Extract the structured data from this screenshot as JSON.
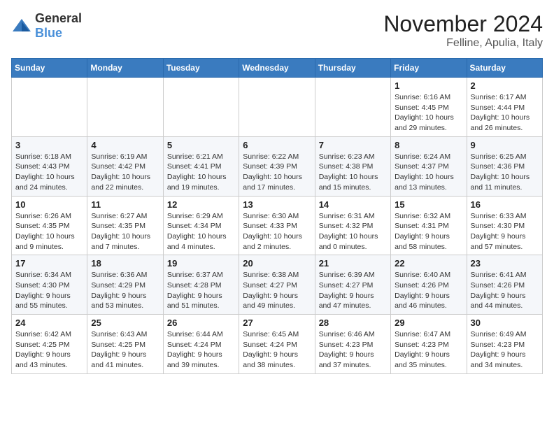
{
  "header": {
    "logo_general": "General",
    "logo_blue": "Blue",
    "month_title": "November 2024",
    "location": "Felline, Apulia, Italy"
  },
  "weekdays": [
    "Sunday",
    "Monday",
    "Tuesday",
    "Wednesday",
    "Thursday",
    "Friday",
    "Saturday"
  ],
  "weeks": [
    [
      {
        "day": "",
        "info": ""
      },
      {
        "day": "",
        "info": ""
      },
      {
        "day": "",
        "info": ""
      },
      {
        "day": "",
        "info": ""
      },
      {
        "day": "",
        "info": ""
      },
      {
        "day": "1",
        "info": "Sunrise: 6:16 AM\nSunset: 4:45 PM\nDaylight: 10 hours and 29 minutes."
      },
      {
        "day": "2",
        "info": "Sunrise: 6:17 AM\nSunset: 4:44 PM\nDaylight: 10 hours and 26 minutes."
      }
    ],
    [
      {
        "day": "3",
        "info": "Sunrise: 6:18 AM\nSunset: 4:43 PM\nDaylight: 10 hours and 24 minutes."
      },
      {
        "day": "4",
        "info": "Sunrise: 6:19 AM\nSunset: 4:42 PM\nDaylight: 10 hours and 22 minutes."
      },
      {
        "day": "5",
        "info": "Sunrise: 6:21 AM\nSunset: 4:41 PM\nDaylight: 10 hours and 19 minutes."
      },
      {
        "day": "6",
        "info": "Sunrise: 6:22 AM\nSunset: 4:39 PM\nDaylight: 10 hours and 17 minutes."
      },
      {
        "day": "7",
        "info": "Sunrise: 6:23 AM\nSunset: 4:38 PM\nDaylight: 10 hours and 15 minutes."
      },
      {
        "day": "8",
        "info": "Sunrise: 6:24 AM\nSunset: 4:37 PM\nDaylight: 10 hours and 13 minutes."
      },
      {
        "day": "9",
        "info": "Sunrise: 6:25 AM\nSunset: 4:36 PM\nDaylight: 10 hours and 11 minutes."
      }
    ],
    [
      {
        "day": "10",
        "info": "Sunrise: 6:26 AM\nSunset: 4:35 PM\nDaylight: 10 hours and 9 minutes."
      },
      {
        "day": "11",
        "info": "Sunrise: 6:27 AM\nSunset: 4:35 PM\nDaylight: 10 hours and 7 minutes."
      },
      {
        "day": "12",
        "info": "Sunrise: 6:29 AM\nSunset: 4:34 PM\nDaylight: 10 hours and 4 minutes."
      },
      {
        "day": "13",
        "info": "Sunrise: 6:30 AM\nSunset: 4:33 PM\nDaylight: 10 hours and 2 minutes."
      },
      {
        "day": "14",
        "info": "Sunrise: 6:31 AM\nSunset: 4:32 PM\nDaylight: 10 hours and 0 minutes."
      },
      {
        "day": "15",
        "info": "Sunrise: 6:32 AM\nSunset: 4:31 PM\nDaylight: 9 hours and 58 minutes."
      },
      {
        "day": "16",
        "info": "Sunrise: 6:33 AM\nSunset: 4:30 PM\nDaylight: 9 hours and 57 minutes."
      }
    ],
    [
      {
        "day": "17",
        "info": "Sunrise: 6:34 AM\nSunset: 4:30 PM\nDaylight: 9 hours and 55 minutes."
      },
      {
        "day": "18",
        "info": "Sunrise: 6:36 AM\nSunset: 4:29 PM\nDaylight: 9 hours and 53 minutes."
      },
      {
        "day": "19",
        "info": "Sunrise: 6:37 AM\nSunset: 4:28 PM\nDaylight: 9 hours and 51 minutes."
      },
      {
        "day": "20",
        "info": "Sunrise: 6:38 AM\nSunset: 4:27 PM\nDaylight: 9 hours and 49 minutes."
      },
      {
        "day": "21",
        "info": "Sunrise: 6:39 AM\nSunset: 4:27 PM\nDaylight: 9 hours and 47 minutes."
      },
      {
        "day": "22",
        "info": "Sunrise: 6:40 AM\nSunset: 4:26 PM\nDaylight: 9 hours and 46 minutes."
      },
      {
        "day": "23",
        "info": "Sunrise: 6:41 AM\nSunset: 4:26 PM\nDaylight: 9 hours and 44 minutes."
      }
    ],
    [
      {
        "day": "24",
        "info": "Sunrise: 6:42 AM\nSunset: 4:25 PM\nDaylight: 9 hours and 43 minutes."
      },
      {
        "day": "25",
        "info": "Sunrise: 6:43 AM\nSunset: 4:25 PM\nDaylight: 9 hours and 41 minutes."
      },
      {
        "day": "26",
        "info": "Sunrise: 6:44 AM\nSunset: 4:24 PM\nDaylight: 9 hours and 39 minutes."
      },
      {
        "day": "27",
        "info": "Sunrise: 6:45 AM\nSunset: 4:24 PM\nDaylight: 9 hours and 38 minutes."
      },
      {
        "day": "28",
        "info": "Sunrise: 6:46 AM\nSunset: 4:23 PM\nDaylight: 9 hours and 37 minutes."
      },
      {
        "day": "29",
        "info": "Sunrise: 6:47 AM\nSunset: 4:23 PM\nDaylight: 9 hours and 35 minutes."
      },
      {
        "day": "30",
        "info": "Sunrise: 6:49 AM\nSunset: 4:23 PM\nDaylight: 9 hours and 34 minutes."
      }
    ]
  ]
}
